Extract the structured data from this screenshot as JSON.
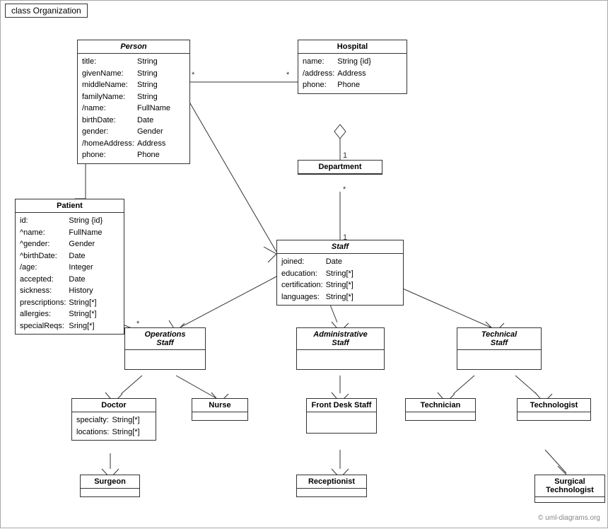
{
  "title": "class Organization",
  "classes": {
    "person": {
      "name": "Person",
      "italic": true,
      "attributes": [
        {
          "name": "title:",
          "type": "String"
        },
        {
          "name": "givenName:",
          "type": "String"
        },
        {
          "name": "middleName:",
          "type": "String"
        },
        {
          "name": "familyName:",
          "type": "String"
        },
        {
          "name": "/name:",
          "type": "FullName"
        },
        {
          "name": "birthDate:",
          "type": "Date"
        },
        {
          "name": "gender:",
          "type": "Gender"
        },
        {
          "name": "/homeAddress:",
          "type": "Address"
        },
        {
          "name": "phone:",
          "type": "Phone"
        }
      ]
    },
    "hospital": {
      "name": "Hospital",
      "italic": false,
      "attributes": [
        {
          "name": "name:",
          "type": "String {id}"
        },
        {
          "name": "/address:",
          "type": "Address"
        },
        {
          "name": "phone:",
          "type": "Phone"
        }
      ]
    },
    "patient": {
      "name": "Patient",
      "italic": false,
      "attributes": [
        {
          "name": "id:",
          "type": "String {id}"
        },
        {
          "name": "^name:",
          "type": "FullName"
        },
        {
          "name": "^gender:",
          "type": "Gender"
        },
        {
          "name": "^birthDate:",
          "type": "Date"
        },
        {
          "name": "/age:",
          "type": "Integer"
        },
        {
          "name": "accepted:",
          "type": "Date"
        },
        {
          "name": "sickness:",
          "type": "History"
        },
        {
          "name": "prescriptions:",
          "type": "String[*]"
        },
        {
          "name": "allergies:",
          "type": "String[*]"
        },
        {
          "name": "specialReqs:",
          "type": "Sring[*]"
        }
      ]
    },
    "department": {
      "name": "Department",
      "italic": false,
      "attributes": []
    },
    "staff": {
      "name": "Staff",
      "italic": true,
      "attributes": [
        {
          "name": "joined:",
          "type": "Date"
        },
        {
          "name": "education:",
          "type": "String[*]"
        },
        {
          "name": "certification:",
          "type": "String[*]"
        },
        {
          "name": "languages:",
          "type": "String[*]"
        }
      ]
    },
    "operations_staff": {
      "name": "Operations Staff",
      "italic": true,
      "attributes": []
    },
    "administrative_staff": {
      "name": "Administrative Staff",
      "italic": true,
      "attributes": []
    },
    "technical_staff": {
      "name": "Technical Staff",
      "italic": true,
      "attributes": []
    },
    "doctor": {
      "name": "Doctor",
      "italic": false,
      "attributes": [
        {
          "name": "specialty:",
          "type": "String[*]"
        },
        {
          "name": "locations:",
          "type": "String[*]"
        }
      ]
    },
    "nurse": {
      "name": "Nurse",
      "italic": false,
      "attributes": []
    },
    "front_desk_staff": {
      "name": "Front Desk Staff",
      "italic": false,
      "attributes": []
    },
    "technician": {
      "name": "Technician",
      "italic": false,
      "attributes": []
    },
    "technologist": {
      "name": "Technologist",
      "italic": false,
      "attributes": []
    },
    "surgeon": {
      "name": "Surgeon",
      "italic": false,
      "attributes": []
    },
    "receptionist": {
      "name": "Receptionist",
      "italic": false,
      "attributes": []
    },
    "surgical_technologist": {
      "name": "Surgical Technologist",
      "italic": false,
      "attributes": []
    }
  },
  "watermark": "© uml-diagrams.org"
}
